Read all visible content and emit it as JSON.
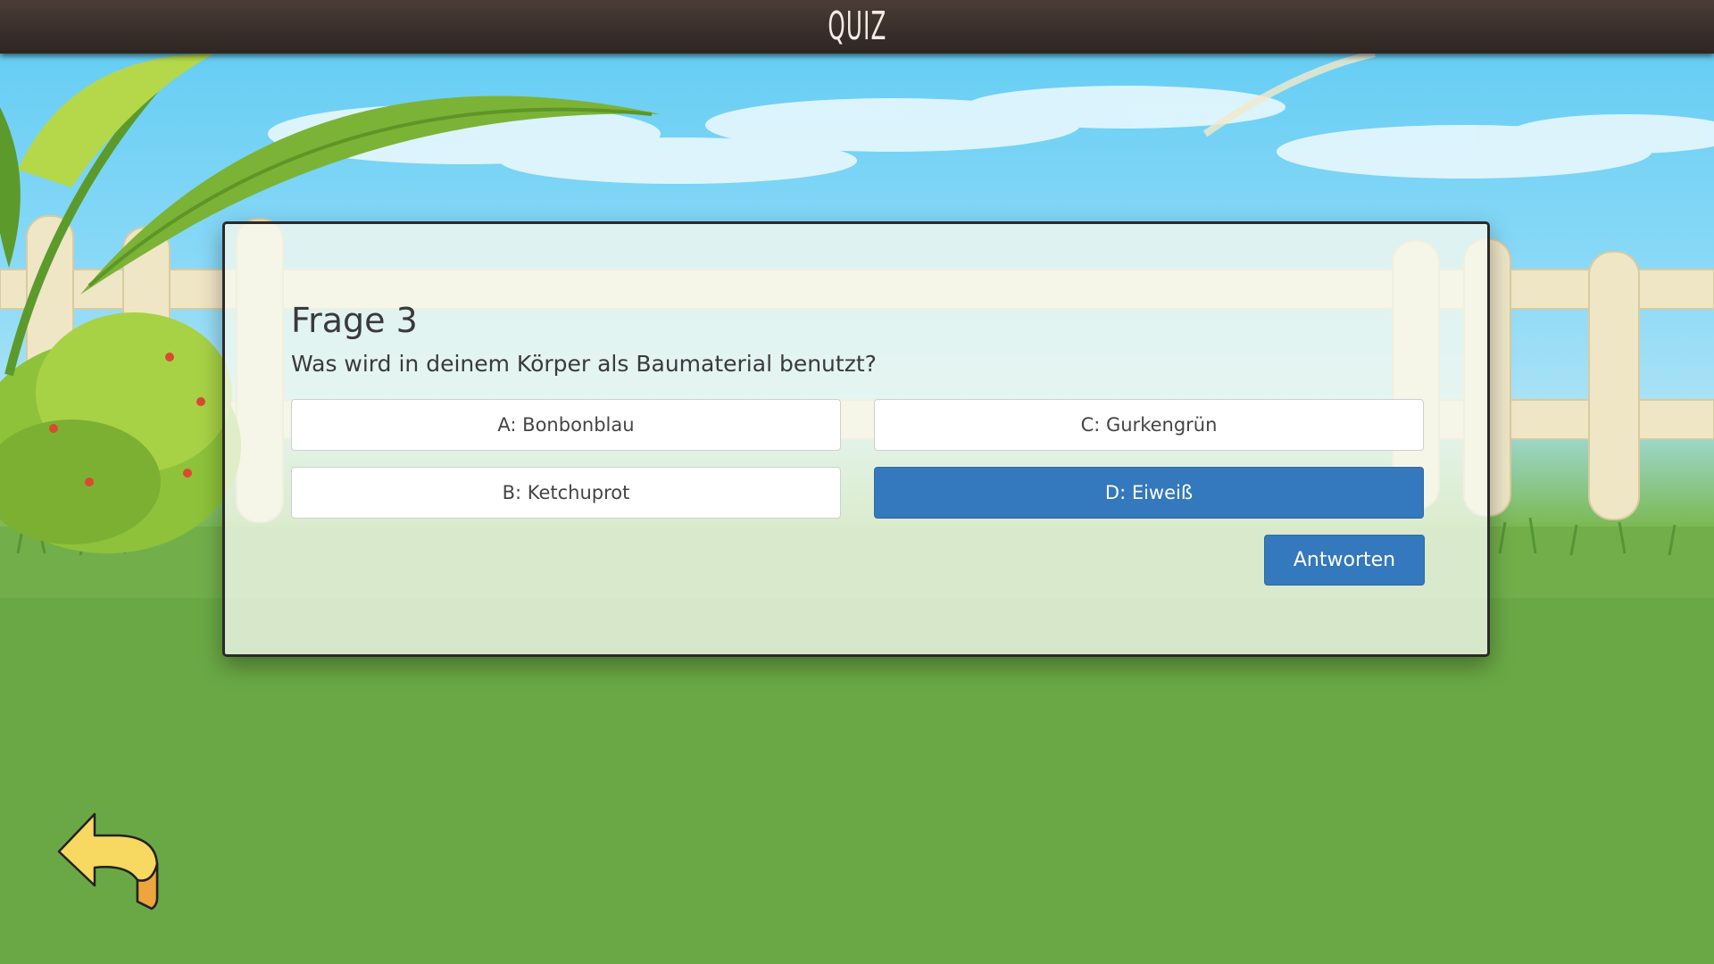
{
  "header": {
    "title": "QUIZ"
  },
  "quiz": {
    "question_title": "Frage 3",
    "question_text": "Was wird in deinem Körper als Baumaterial benutzt?",
    "answers": [
      {
        "label": "A: Bonbonblau",
        "selected": false
      },
      {
        "label": "B: Ketchuprot",
        "selected": false
      },
      {
        "label": "C: Gurkengrün",
        "selected": false
      },
      {
        "label": "D: Eiweiß",
        "selected": true
      }
    ],
    "submit_label": "Antworten"
  },
  "navigation": {
    "back_icon": "back-arrow-icon"
  },
  "colors": {
    "accent": "#3478bd",
    "header_bg": "#3a2f2a",
    "grass": "#6aa845",
    "sky": "#5ecbf3"
  }
}
